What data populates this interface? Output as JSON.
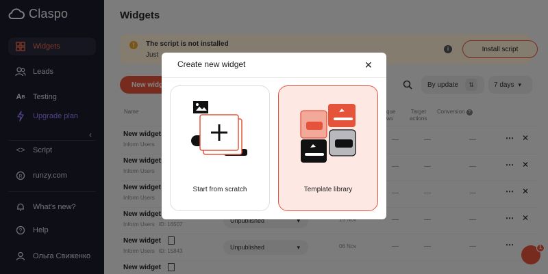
{
  "app": {
    "name": "Claspo"
  },
  "sidebar": {
    "items": [
      {
        "label": "Widgets",
        "icon": "grid-icon"
      },
      {
        "label": "Leads",
        "icon": "users-icon"
      },
      {
        "label": "Testing",
        "icon": "ab-icon"
      },
      {
        "label": "Upgrade plan",
        "icon": "lightning-icon"
      },
      {
        "label": "Script",
        "icon": "code-icon"
      },
      {
        "label": "runzy.com",
        "icon": "registered-icon"
      },
      {
        "label": "What's new?",
        "icon": "bell-icon"
      },
      {
        "label": "Help",
        "icon": "help-icon"
      },
      {
        "label": "Ольга Свиженко",
        "icon": "user-icon"
      }
    ],
    "active_index": 0
  },
  "page": {
    "title": "Widgets"
  },
  "warning": {
    "title": "The script is not installed",
    "text": "Just",
    "install_label": "Install script"
  },
  "toolbar": {
    "new_label": "New widg",
    "sort_label": "By update",
    "range_label": "7 days"
  },
  "table": {
    "headers": {
      "name": "Name",
      "unique_views": "que\nws",
      "target_actions": "Target\nactions",
      "conversion": "Conversion"
    },
    "rows": [
      {
        "name": "New widget",
        "sub": "Inform Users",
        "id": "",
        "status": "",
        "date": ""
      },
      {
        "name": "New widget",
        "sub": "Inform Users",
        "id": "",
        "status": "",
        "date": ""
      },
      {
        "name": "New widget",
        "sub": "Inform Users",
        "id": "",
        "status": "",
        "date": ""
      },
      {
        "name": "New widget",
        "sub": "Inform Users",
        "id": "ID: 16507",
        "status": "Unpublished",
        "date": "15 Nov"
      },
      {
        "name": "New widget",
        "sub": "Inform Users",
        "id": "ID: 15843",
        "status": "Unpublished",
        "date": "06 Nov"
      },
      {
        "name": "New widget",
        "sub": "",
        "id": "",
        "status": "",
        "date": ""
      }
    ],
    "dash": "—"
  },
  "chat": {
    "badge": "1"
  },
  "modal": {
    "title": "Create new widget",
    "options": [
      {
        "label": "Start from scratch"
      },
      {
        "label": "Template library"
      }
    ]
  }
}
